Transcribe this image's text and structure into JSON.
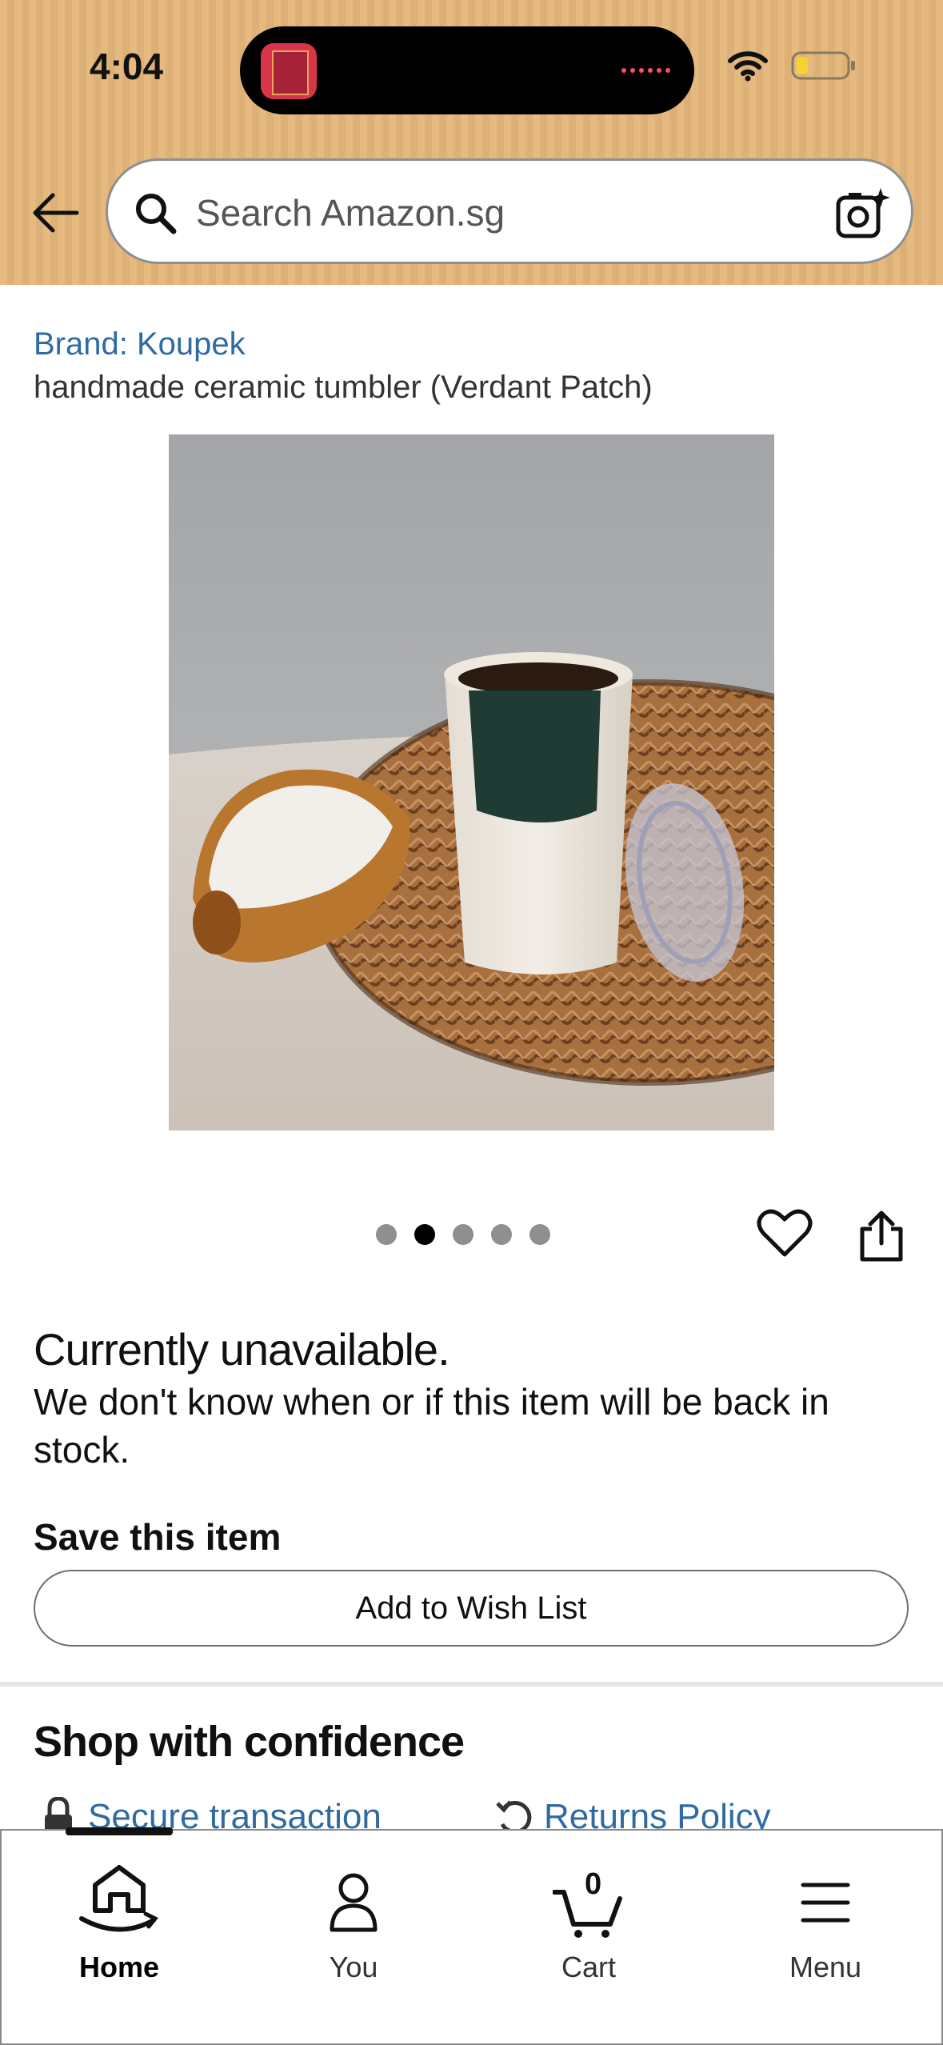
{
  "status_bar": {
    "time": "4:04"
  },
  "search": {
    "placeholder": "Search Amazon.sg"
  },
  "product": {
    "brand": "Brand: Koupek",
    "title": "handmade ceramic tumbler (Verdant Patch)",
    "image_count": 5,
    "active_image_index": 1
  },
  "availability": {
    "status": "Currently unavailable.",
    "message": "We don't know when or if this item will be back in stock."
  },
  "save": {
    "heading": "Save this item",
    "button": "Add to Wish List"
  },
  "confidence": {
    "title": "Shop with confidence",
    "items": [
      {
        "label": "Secure transaction",
        "icon": "lock-icon"
      },
      {
        "label": "Returns Policy",
        "icon": "returns-icon"
      }
    ]
  },
  "bottom_nav": {
    "items": [
      {
        "label": "Home",
        "icon": "home-icon",
        "active": true
      },
      {
        "label": "You",
        "icon": "person-icon",
        "active": false
      },
      {
        "label": "Cart",
        "icon": "cart-icon",
        "count": "0",
        "active": false
      },
      {
        "label": "Menu",
        "icon": "menu-icon",
        "active": false
      }
    ]
  },
  "colors": {
    "header_bg": "#e6b97f",
    "link": "#2f6aa3",
    "text": "#0f1111"
  }
}
